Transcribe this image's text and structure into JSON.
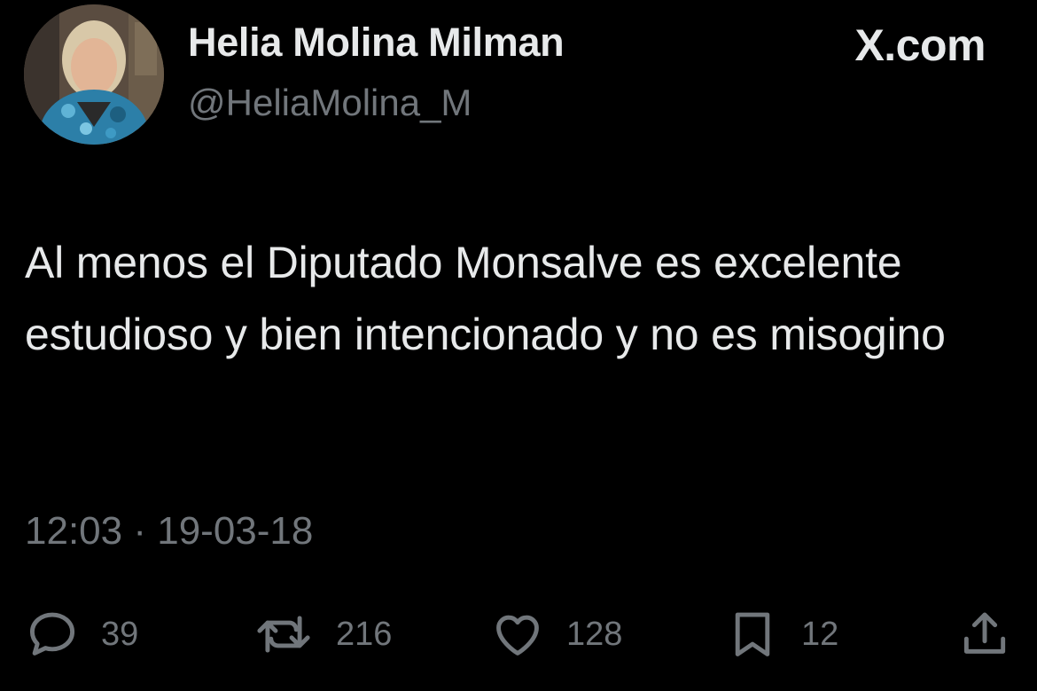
{
  "author": {
    "display_name": "Helia Molina Milman",
    "handle": "@HeliaMolina_M"
  },
  "brand": "X.com",
  "tweet": {
    "text": "Al menos el Diputado Monsalve es excelente estudioso y bien intencionado y no es misogino",
    "time": "12:03",
    "separator": "·",
    "date": "19-03-18"
  },
  "actions": {
    "replies": "39",
    "reposts": "216",
    "likes": "128",
    "bookmarks": "12"
  },
  "icons": {
    "reply": "reply-icon",
    "repost": "repost-icon",
    "like": "heart-icon",
    "bookmark": "bookmark-icon",
    "share": "share-icon"
  },
  "colors": {
    "background": "#000000",
    "primary_text": "#e7e9ea",
    "secondary_text": "#71767b"
  }
}
